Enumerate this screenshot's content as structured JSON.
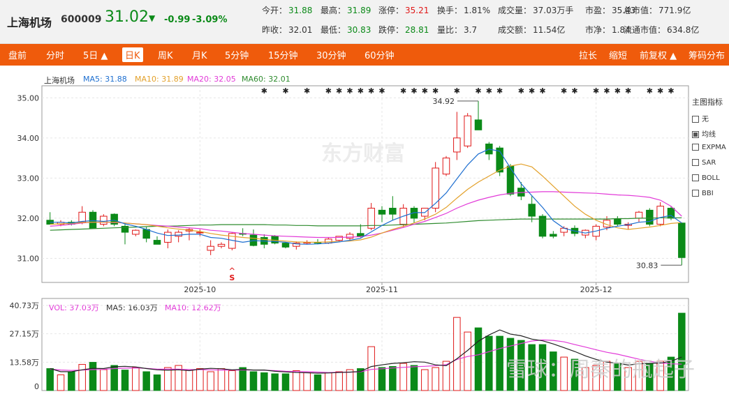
{
  "header": {
    "name": "上海机场",
    "code": "600009",
    "price": "31.02",
    "arrow": "▼",
    "change": "-0.99",
    "change_pct": "-3.09%",
    "quotes": [
      {
        "label": "今开",
        "value": "31.88",
        "color": "#0b8a18"
      },
      {
        "label": "最高",
        "value": "31.89",
        "color": "#0b8a18"
      },
      {
        "label": "涨停",
        "value": "35.21",
        "color": "#e01818"
      },
      {
        "label": "换手",
        "value": "1.81%",
        "color": "#333333"
      },
      {
        "label": "成交量",
        "value": "37.03万手",
        "color": "#333333"
      },
      {
        "label": "市盈",
        "value": "35.43",
        "color": "#333333"
      },
      {
        "label": "总市值",
        "value": "771.9亿",
        "color": "#333333"
      },
      {
        "label": "昨收",
        "value": "32.01",
        "color": "#333333"
      },
      {
        "label": "最低",
        "value": "30.83",
        "color": "#0b8a18"
      },
      {
        "label": "跌停",
        "value": "28.81",
        "color": "#0b8a18"
      },
      {
        "label": "量比",
        "value": "3.7",
        "color": "#333333"
      },
      {
        "label": "成交额",
        "value": "11.54亿",
        "color": "#333333"
      },
      {
        "label": "市净",
        "value": "1.84",
        "color": "#333333"
      },
      {
        "label": "流通市值",
        "value": "634.8亿",
        "color": "#333333"
      }
    ]
  },
  "toolbar": {
    "left": [
      "盘前",
      "分时",
      "5日 ▲",
      "日K",
      "周K",
      "月K",
      "5分钟",
      "15分钟",
      "30分钟",
      "60分钟"
    ],
    "active": "日K",
    "right": [
      "拉长",
      "缩短",
      "前复权 ▲",
      "筹码分布"
    ]
  },
  "legend": {
    "name": "上海机场",
    "ma5": "MA5: 31.88",
    "ma10": "MA10: 31.89",
    "ma20": "MA20: 32.05",
    "ma60": "MA60: 32.01"
  },
  "indicators": {
    "title": "主图指标",
    "items": [
      {
        "label": "无",
        "checked": false
      },
      {
        "label": "均线",
        "checked": true
      },
      {
        "label": "EXPMA",
        "checked": false
      },
      {
        "label": "SAR",
        "checked": false
      },
      {
        "label": "BOLL",
        "checked": false
      },
      {
        "label": "BBI",
        "checked": false
      }
    ]
  },
  "volume_legend": {
    "vol": "VOL: 37.03万",
    "ma5": "MA5: 16.03万",
    "ma10": "MA10: 12.62万"
  },
  "watermark_main": "东方财富",
  "watermark_bottom": "雪球：周秦的瓶起子",
  "colors": {
    "up": "#e01818",
    "down": "#0b8a18",
    "ma5": "#1e6fd0",
    "ma10": "#e3a12b",
    "ma20": "#e23ad8",
    "ma60": "#2e8b2e",
    "toolbar": "#ef5b0c"
  },
  "chart_data": {
    "type": "candlestick",
    "y_ticks": [
      "35.00",
      "34.00",
      "33.00",
      "32.00",
      "31.00"
    ],
    "y_range": [
      30.4,
      35.3
    ],
    "x_ticks": [
      {
        "label": "2025-10",
        "index": 14
      },
      {
        "label": "2025-11",
        "index": 31
      },
      {
        "label": "2025-12",
        "index": 51
      }
    ],
    "max_label": "34.92",
    "min_label": "30.83",
    "candles": [
      {
        "o": 31.95,
        "h": 32.15,
        "l": 31.85,
        "c": 31.85
      },
      {
        "o": 31.85,
        "h": 31.95,
        "l": 31.8,
        "c": 31.9
      },
      {
        "o": 31.9,
        "h": 31.95,
        "l": 31.82,
        "c": 31.85
      },
      {
        "o": 31.9,
        "h": 32.3,
        "l": 31.85,
        "c": 32.15
      },
      {
        "o": 32.15,
        "h": 32.2,
        "l": 31.75,
        "c": 31.75
      },
      {
        "o": 31.85,
        "h": 32.1,
        "l": 31.8,
        "c": 32.05
      },
      {
        "o": 32.1,
        "h": 32.12,
        "l": 31.8,
        "c": 31.85
      },
      {
        "o": 31.8,
        "h": 31.85,
        "l": 31.35,
        "c": 31.65
      },
      {
        "o": 31.6,
        "h": 31.72,
        "l": 31.55,
        "c": 31.7
      },
      {
        "o": 31.72,
        "h": 31.78,
        "l": 31.4,
        "c": 31.5
      },
      {
        "o": 31.45,
        "h": 31.55,
        "l": 31.35,
        "c": 31.35
      },
      {
        "o": 31.4,
        "h": 31.72,
        "l": 31.25,
        "c": 31.65
      },
      {
        "o": 31.55,
        "h": 31.7,
        "l": 31.4,
        "c": 31.65
      },
      {
        "o": 31.68,
        "h": 31.75,
        "l": 31.45,
        "c": 31.72
      },
      {
        "o": 31.65,
        "h": 31.72,
        "l": 31.55,
        "c": 31.65
      },
      {
        "o": 31.2,
        "h": 31.45,
        "l": 31.08,
        "c": 31.3
      },
      {
        "o": 31.3,
        "h": 31.4,
        "l": 31.25,
        "c": 31.35
      },
      {
        "o": 31.25,
        "h": 31.65,
        "l": 31.2,
        "c": 31.62
      },
      {
        "o": 31.62,
        "h": 31.75,
        "l": 31.55,
        "c": 31.6
      },
      {
        "o": 31.58,
        "h": 31.72,
        "l": 31.3,
        "c": 31.32
      },
      {
        "o": 31.52,
        "h": 31.6,
        "l": 31.25,
        "c": 31.35
      },
      {
        "o": 31.55,
        "h": 31.58,
        "l": 31.35,
        "c": 31.38
      },
      {
        "o": 31.38,
        "h": 31.4,
        "l": 31.25,
        "c": 31.28
      },
      {
        "o": 31.3,
        "h": 31.42,
        "l": 31.22,
        "c": 31.38
      },
      {
        "o": 31.38,
        "h": 31.45,
        "l": 31.35,
        "c": 31.4
      },
      {
        "o": 31.4,
        "h": 31.48,
        "l": 31.35,
        "c": 31.38
      },
      {
        "o": 31.38,
        "h": 31.52,
        "l": 31.36,
        "c": 31.48
      },
      {
        "o": 31.45,
        "h": 31.55,
        "l": 31.4,
        "c": 31.55
      },
      {
        "o": 31.5,
        "h": 31.65,
        "l": 31.45,
        "c": 31.6
      },
      {
        "o": 31.62,
        "h": 31.85,
        "l": 31.52,
        "c": 31.55
      },
      {
        "o": 31.75,
        "h": 32.38,
        "l": 31.7,
        "c": 32.25
      },
      {
        "o": 32.2,
        "h": 32.3,
        "l": 31.9,
        "c": 32.1
      },
      {
        "o": 32.25,
        "h": 32.55,
        "l": 31.95,
        "c": 32.1
      },
      {
        "o": 31.85,
        "h": 32.35,
        "l": 31.78,
        "c": 32.25
      },
      {
        "o": 32.25,
        "h": 32.3,
        "l": 31.88,
        "c": 32.0
      },
      {
        "o": 32.05,
        "h": 32.15,
        "l": 31.95,
        "c": 32.25
      },
      {
        "o": 32.25,
        "h": 33.4,
        "l": 32.15,
        "c": 33.25
      },
      {
        "o": 33.1,
        "h": 33.55,
        "l": 33.05,
        "c": 33.5
      },
      {
        "o": 33.65,
        "h": 34.65,
        "l": 33.45,
        "c": 34.0
      },
      {
        "o": 33.8,
        "h": 34.62,
        "l": 33.75,
        "c": 34.55
      },
      {
        "o": 34.45,
        "h": 34.92,
        "l": 34.25,
        "c": 34.2
      },
      {
        "o": 33.85,
        "h": 33.9,
        "l": 33.45,
        "c": 33.6
      },
      {
        "o": 33.75,
        "h": 33.8,
        "l": 33.05,
        "c": 33.15
      },
      {
        "o": 33.3,
        "h": 33.35,
        "l": 32.55,
        "c": 32.6
      },
      {
        "o": 32.75,
        "h": 32.9,
        "l": 32.45,
        "c": 32.55
      },
      {
        "o": 32.35,
        "h": 32.55,
        "l": 31.9,
        "c": 32.05
      },
      {
        "o": 32.05,
        "h": 32.1,
        "l": 31.5,
        "c": 31.55
      },
      {
        "o": 31.6,
        "h": 31.68,
        "l": 31.5,
        "c": 31.55
      },
      {
        "o": 31.65,
        "h": 31.8,
        "l": 31.55,
        "c": 31.75
      },
      {
        "o": 31.75,
        "h": 31.82,
        "l": 31.55,
        "c": 31.62
      },
      {
        "o": 31.58,
        "h": 31.72,
        "l": 31.5,
        "c": 31.7
      },
      {
        "o": 31.55,
        "h": 31.85,
        "l": 31.45,
        "c": 31.8
      },
      {
        "o": 31.78,
        "h": 32.05,
        "l": 31.7,
        "c": 31.95
      },
      {
        "o": 31.98,
        "h": 32.05,
        "l": 31.8,
        "c": 31.85
      },
      {
        "o": 31.82,
        "h": 31.9,
        "l": 31.72,
        "c": 31.85
      },
      {
        "o": 32.0,
        "h": 32.18,
        "l": 31.9,
        "c": 32.15
      },
      {
        "o": 32.2,
        "h": 32.25,
        "l": 31.8,
        "c": 31.85
      },
      {
        "o": 31.85,
        "h": 32.4,
        "l": 31.8,
        "c": 32.3
      },
      {
        "o": 32.25,
        "h": 32.3,
        "l": 31.95,
        "c": 32.0
      },
      {
        "o": 31.88,
        "h": 31.89,
        "l": 30.83,
        "c": 31.02
      }
    ],
    "ma5": [
      31.9,
      31.9,
      31.88,
      31.92,
      31.94,
      31.92,
      31.95,
      31.86,
      31.8,
      31.72,
      31.63,
      31.57,
      31.58,
      31.6,
      31.6,
      31.52,
      31.5,
      31.45,
      31.4,
      31.44,
      31.43,
      31.42,
      31.4,
      31.36,
      31.35,
      31.36,
      31.38,
      31.41,
      31.45,
      31.5,
      31.66,
      31.82,
      31.95,
      32.05,
      32.14,
      32.14,
      32.37,
      32.63,
      32.98,
      33.33,
      33.6,
      33.72,
      33.67,
      33.25,
      32.86,
      32.56,
      32.27,
      31.94,
      31.75,
      31.68,
      31.63,
      31.68,
      31.75,
      31.8,
      31.84,
      31.9,
      31.92,
      32.02,
      32.07,
      31.88
    ],
    "ma10": [
      31.85,
      31.86,
      31.87,
      31.89,
      31.9,
      31.9,
      31.9,
      31.88,
      31.86,
      31.84,
      31.8,
      31.76,
      31.73,
      31.7,
      31.67,
      31.62,
      31.58,
      31.55,
      31.52,
      31.5,
      31.47,
      31.45,
      31.43,
      31.41,
      31.4,
      31.4,
      31.41,
      31.42,
      31.43,
      31.46,
      31.53,
      31.63,
      31.72,
      31.8,
      31.88,
      31.98,
      32.1,
      32.27,
      32.5,
      32.72,
      32.9,
      33.05,
      33.2,
      33.3,
      33.35,
      33.28,
      33.05,
      32.8,
      32.55,
      32.3,
      32.1,
      31.95,
      31.84,
      31.76,
      31.72,
      31.75,
      31.78,
      31.82,
      31.87,
      31.89
    ],
    "ma20": [
      31.8,
      31.82,
      31.85,
      31.88,
      31.9,
      31.9,
      31.89,
      31.88,
      31.86,
      31.84,
      31.82,
      31.8,
      31.78,
      31.76,
      31.74,
      31.7,
      31.68,
      31.65,
      31.62,
      31.6,
      31.58,
      31.56,
      31.55,
      31.54,
      31.53,
      31.52,
      31.52,
      31.52,
      31.53,
      31.54,
      31.58,
      31.63,
      31.7,
      31.77,
      31.85,
      31.92,
      32.02,
      32.12,
      32.25,
      32.36,
      32.45,
      32.52,
      32.58,
      32.62,
      32.64,
      32.65,
      32.66,
      32.66,
      32.65,
      32.64,
      32.63,
      32.62,
      32.6,
      32.58,
      32.57,
      32.55,
      32.52,
      32.45,
      32.3,
      32.05
    ],
    "ma60": [
      31.7,
      31.71,
      31.72,
      31.73,
      31.74,
      31.75,
      31.76,
      31.77,
      31.78,
      31.79,
      31.8,
      31.8,
      31.81,
      31.82,
      31.83,
      31.83,
      31.84,
      31.84,
      31.84,
      31.84,
      31.84,
      31.83,
      31.83,
      31.82,
      31.82,
      31.81,
      31.81,
      31.81,
      31.81,
      31.81,
      31.82,
      31.82,
      31.83,
      31.84,
      31.85,
      31.86,
      31.87,
      31.88,
      31.9,
      31.92,
      31.94,
      31.95,
      31.96,
      31.97,
      31.98,
      31.98,
      31.98,
      31.98,
      31.98,
      31.98,
      31.98,
      31.98,
      31.98,
      31.99,
      31.99,
      32.0,
      32.0,
      32.01,
      32.01,
      32.01
    ],
    "volume_ticks": [
      "40.73万",
      "27.15万",
      "13.58万",
      "0"
    ],
    "volume_max": 40.73,
    "volume": [
      10.5,
      7.5,
      9,
      12.5,
      13.5,
      10,
      12,
      9.8,
      11,
      9,
      7.5,
      11,
      12,
      10,
      10.5,
      9,
      10.5,
      9.5,
      11,
      9,
      8.5,
      8,
      8,
      9.5,
      8.5,
      7.5,
      8.5,
      9,
      10,
      10.5,
      21,
      11,
      11.5,
      13,
      12,
      10,
      11,
      14,
      35,
      28,
      30,
      26,
      26,
      25,
      24,
      22,
      22,
      18.5,
      16,
      15,
      11,
      12,
      14,
      13,
      11,
      14,
      13,
      14,
      16,
      37.03
    ],
    "vol_ma5": [
      10.5,
      9,
      9,
      9.9,
      10.6,
      10.5,
      11.4,
      11.6,
      11.3,
      10.5,
      9.9,
      9.7,
      9.9,
      9.5,
      10.2,
      10.6,
      10.4,
      9.9,
      10.1,
      9.8,
      9.8,
      9.2,
      8.9,
      8.6,
      8.5,
      8.3,
      8.4,
      8.6,
      8.8,
      9.1,
      11.5,
      12.3,
      13,
      13.3,
      13.8,
      13.6,
      12.3,
      11.9,
      15.2,
      19.2,
      23.6,
      26.6,
      29,
      27,
      26.2,
      24.6,
      23.8,
      22.3,
      20.5,
      18.7,
      16.6,
      14.9,
      13.6,
      13.1,
      12.2,
      12.8,
      13,
      13.2,
      14,
      16.03
    ],
    "vol_ma10": [
      10.2,
      9.8,
      9.6,
      9.8,
      10,
      10.1,
      10.5,
      10.7,
      10.8,
      10.6,
      10.2,
      10.2,
      10.2,
      10,
      10,
      9.9,
      9.8,
      9.8,
      9.8,
      9.8,
      9.7,
      9.5,
      9.2,
      9.1,
      9,
      8.8,
      8.6,
      8.7,
      8.8,
      8.9,
      10.1,
      10.4,
      10.8,
      11.1,
      11.4,
      11.6,
      11.9,
      12.4,
      14.9,
      16.3,
      17.1,
      18.6,
      20.1,
      21.3,
      22.5,
      23.7,
      24.2,
      24,
      23.3,
      22,
      20.8,
      19.5,
      18.3,
      17.4,
      16.2,
      15,
      14,
      13.2,
      12.8,
      12.62
    ],
    "star_rows": [
      20,
      22,
      24,
      26,
      27,
      28,
      29,
      30,
      31,
      33,
      34,
      35,
      36,
      38,
      40,
      41,
      42,
      44,
      45,
      46,
      48,
      49,
      51,
      52,
      53,
      54,
      56,
      57,
      58
    ]
  }
}
